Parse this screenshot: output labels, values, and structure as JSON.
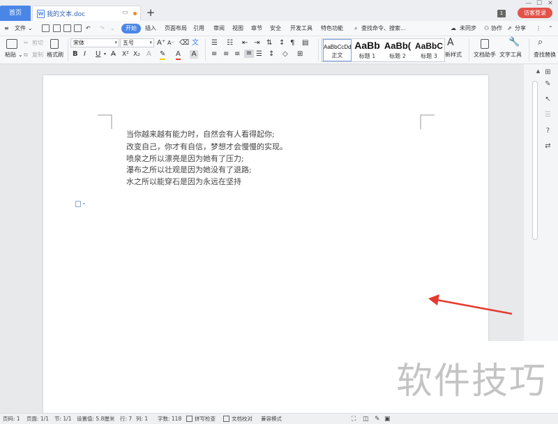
{
  "titlebar": {
    "home_tab": "首页",
    "doc_tab": "我的文本.doc",
    "doc_icon": "W",
    "new_tab": "+",
    "badge": "1",
    "login": "访客登录",
    "window_controls": [
      "—",
      "☐",
      "✕"
    ]
  },
  "menu": {
    "file": "文件",
    "file_caret": "⌄",
    "tabs": [
      "开始",
      "插入",
      "页面布局",
      "引用",
      "审阅",
      "视图",
      "章节",
      "安全",
      "开发工具",
      "特色功能"
    ],
    "search": "查找命令、搜索...",
    "sync": "未同步",
    "collab": "协作",
    "share": "分享",
    "more": "⋮",
    "collapse": "⌃"
  },
  "ribbon": {
    "paste": "粘贴",
    "cut": "剪切",
    "copy": "复制",
    "format_painter": "格式刷",
    "font_name": "宋体",
    "font_size": "五号",
    "grow_font": "A⁺",
    "shrink_font": "A⁻",
    "bold": "B",
    "italic": "I",
    "underline": "U",
    "strike": "A̶",
    "superscript": "X²",
    "subscript": "X₂",
    "font_color": "A",
    "char_border": "A",
    "styles": [
      {
        "sample": "AaBbCcDd",
        "name": "正文"
      },
      {
        "sample": "AaBb",
        "name": "标题 1"
      },
      {
        "sample": "AaBb(",
        "name": "标题 2"
      },
      {
        "sample": "AaBbC",
        "name": "标题 3"
      }
    ],
    "new_style": "新样式",
    "doc_assistant": "文档助手",
    "text_tools": "文字工具",
    "find_replace": "查找替换"
  },
  "document": {
    "lines": [
      "当你越来越有能力时，自然会有人看得起你;",
      "改变自己，你才有自信，梦想才会慢慢的实现。",
      "喷泉之所以漂亮是因为她有了压力;",
      "瀑布之所以壮观是因为她没有了退路;",
      "水之所以能穿石是因为永远在坚持"
    ]
  },
  "watermark": "软件技巧",
  "statusbar": {
    "page_num": "页码: 1",
    "pages": "页面: 1/1",
    "section": "节: 1/1",
    "setting": "设置值: 5.8厘米",
    "row": "行: 7",
    "col": "列: 1",
    "words": "字数: 118",
    "spell": "拼写检查",
    "proof": "文档校对",
    "compat": "兼容模式"
  },
  "colors": {
    "accent": "#4a86e8",
    "login": "#e2524a",
    "arrow": "#e53a30"
  }
}
